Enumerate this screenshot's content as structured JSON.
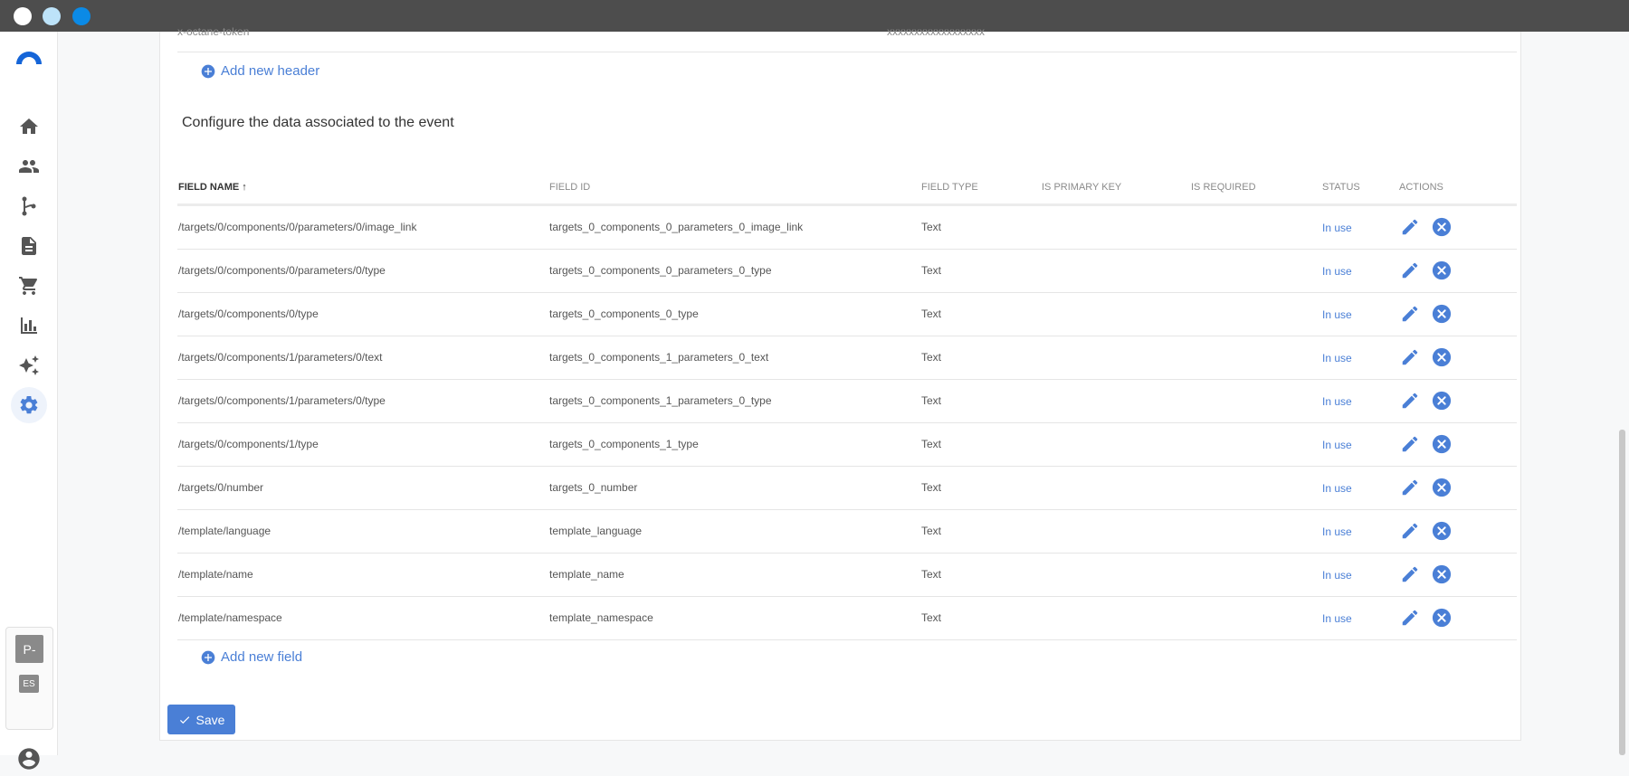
{
  "sidebar": {
    "items": [
      {
        "icon": "home-icon"
      },
      {
        "icon": "people-icon"
      },
      {
        "icon": "flow-icon"
      },
      {
        "icon": "document-icon"
      },
      {
        "icon": "cart-icon"
      },
      {
        "icon": "bar-chart-icon"
      },
      {
        "icon": "sparkle-icon"
      },
      {
        "icon": "gear-icon",
        "active": true
      }
    ],
    "workspace": {
      "avatar": "P-",
      "lang": "ES"
    }
  },
  "headers_section": {
    "prev_row": {
      "name": "x-octane-token",
      "value": "xxxxxxxxxxxxxxxxxx"
    },
    "add_label": "Add new header"
  },
  "fields_section": {
    "title": "Configure the data associated to the event",
    "columns": {
      "field_name": "FIELD NAME",
      "field_id": "FIELD ID",
      "field_type": "FIELD TYPE",
      "primary_key": "IS PRIMARY KEY",
      "required": "IS REQUIRED",
      "status": "STATUS",
      "actions": "ACTIONS"
    },
    "rows": [
      {
        "name": "/targets/0/components/0/parameters/0/image_link",
        "id": "targets_0_components_0_parameters_0_image_link",
        "type": "Text",
        "status": "In use"
      },
      {
        "name": "/targets/0/components/0/parameters/0/type",
        "id": "targets_0_components_0_parameters_0_type",
        "type": "Text",
        "status": "In use"
      },
      {
        "name": "/targets/0/components/0/type",
        "id": "targets_0_components_0_type",
        "type": "Text",
        "status": "In use"
      },
      {
        "name": "/targets/0/components/1/parameters/0/text",
        "id": "targets_0_components_1_parameters_0_text",
        "type": "Text",
        "status": "In use"
      },
      {
        "name": "/targets/0/components/1/parameters/0/type",
        "id": "targets_0_components_1_parameters_0_type",
        "type": "Text",
        "status": "In use"
      },
      {
        "name": "/targets/0/components/1/type",
        "id": "targets_0_components_1_type",
        "type": "Text",
        "status": "In use"
      },
      {
        "name": "/targets/0/number",
        "id": "targets_0_number",
        "type": "Text",
        "status": "In use"
      },
      {
        "name": "/template/language",
        "id": "template_language",
        "type": "Text",
        "status": "In use"
      },
      {
        "name": "/template/name",
        "id": "template_name",
        "type": "Text",
        "status": "In use"
      },
      {
        "name": "/template/namespace",
        "id": "template_namespace",
        "type": "Text",
        "status": "In use"
      }
    ],
    "add_label": "Add new field"
  },
  "save_label": "Save",
  "colors": {
    "accent": "#4a7fd6",
    "titlebar": "#4d4d4d"
  }
}
